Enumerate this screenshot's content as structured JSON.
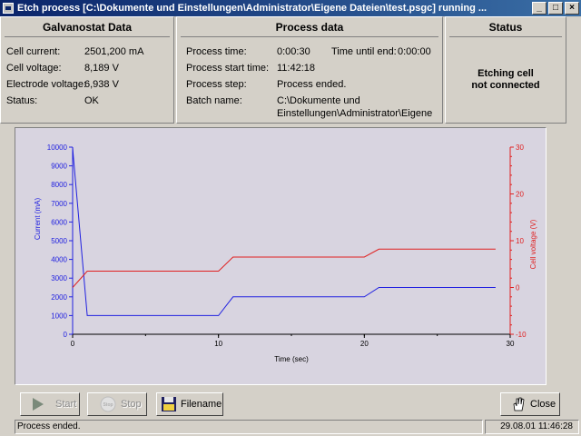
{
  "window": {
    "title": "Etch process [C:\\Dokumente und Einstellungen\\Administrator\\Eigene Dateien\\test.psgc] running ...",
    "controls": [
      "_",
      "□",
      "×"
    ]
  },
  "galvanostat": {
    "title": "Galvanostat Data",
    "rows": [
      {
        "label": "Cell current:",
        "value": "2501,200 mA"
      },
      {
        "label": "Cell voltage:",
        "value": "8,189 V"
      },
      {
        "label": "Electrode voltage:",
        "value": "6,938 V"
      },
      {
        "label": "Status:",
        "value": "OK"
      }
    ]
  },
  "process": {
    "title": "Process data",
    "time_label": "Process time:",
    "time_value": "0:00:30",
    "remaining_label": "Time until end:",
    "remaining_value": "0:00:00",
    "start_label": "Process start time:",
    "start_value": "11:42:18",
    "step_label": "Process step:",
    "step_value": "Process ended.",
    "batch_label": "Batch name:",
    "batch_value_line1": "C:\\Dokumente und",
    "batch_value_line2": "Einstellungen\\Administrator\\Eigene"
  },
  "status_panel": {
    "title": "Status",
    "line1": "Etching cell",
    "line2": "not connected"
  },
  "chart_data": {
    "type": "line",
    "xlabel": "Time (sec)",
    "ylabel_left": "Current (mA)",
    "ylabel_right": "Cell voltage (V)",
    "xlim": [
      0,
      30
    ],
    "ylim_left": [
      0,
      10000
    ],
    "ylim_right": [
      -10,
      30
    ],
    "x_ticks": [
      "0",
      "10",
      "20",
      "30"
    ],
    "left_ticks": [
      "0",
      "1000",
      "2000",
      "3000",
      "4000",
      "5000",
      "6000",
      "7000",
      "8000",
      "9000",
      "10000"
    ],
    "right_ticks": [
      "-10",
      "0",
      "10",
      "20",
      "30"
    ],
    "series": [
      {
        "name": "Current (mA)",
        "axis": "left",
        "color": "#2020e0",
        "x": [
          0,
          0.05,
          1,
          10,
          11,
          20,
          21,
          29
        ],
        "y": [
          10000,
          9500,
          1000,
          1000,
          2000,
          2000,
          2500,
          2500
        ]
      },
      {
        "name": "Cell voltage (V)",
        "axis": "right",
        "color": "#e02020",
        "x": [
          0,
          1,
          10,
          11,
          20,
          21,
          29
        ],
        "y": [
          0,
          3.5,
          3.5,
          6.5,
          6.5,
          8.2,
          8.2
        ]
      }
    ]
  },
  "buttons": {
    "start": "Start",
    "stop_icon": "Stop",
    "stop": "Stop",
    "filename": "Filename",
    "close": "Close"
  },
  "statusbar": {
    "message": "Process ended.",
    "datetime": "29.08.01 11:46:28"
  }
}
